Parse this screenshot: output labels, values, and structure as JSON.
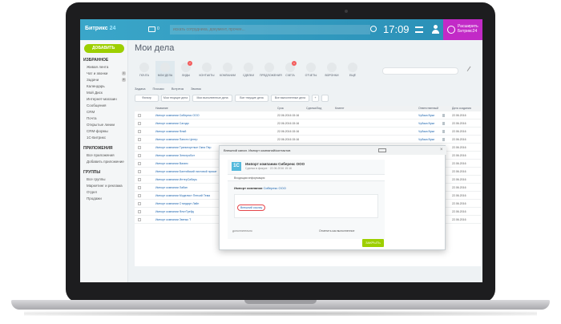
{
  "topbar": {
    "logo_name": "Битрикс",
    "logo_num": "24",
    "chat_count": "0",
    "search_placeholder": "искать сотрудника, документ, прочее...",
    "clock": "17:09",
    "expand_label_1": "Расширить",
    "expand_label_2": "Битрикс24"
  },
  "sidebar": {
    "add_label": "ДОБАВИТЬ",
    "section_favorites": "ИЗБРАННОЕ",
    "favorites": [
      "Живая лента",
      "Чат и звонки",
      "Задачи",
      "Календарь",
      "Мой Диск",
      "Интернет-магазин",
      "Сообщения",
      "CRM",
      "Почта",
      "Открытые линии",
      "CRM-формы",
      "1С-Битрикс"
    ],
    "badges": [
      "1",
      "8"
    ],
    "section_apps": "ПРИЛОЖЕНИЯ",
    "apps": [
      "Все приложения",
      "Добавить приложение"
    ],
    "section_groups": "ГРУППЫ",
    "groups": [
      "Все группы",
      "Маркетинг и реклама",
      "Отдел",
      "Продажи"
    ]
  },
  "page_title": "Мои дела",
  "tabs": [
    {
      "label": "ПОЧТА",
      "count": ""
    },
    {
      "label": "МОИ ДЕЛА",
      "count": ""
    },
    {
      "label": "ЛИДЫ",
      "count": "7"
    },
    {
      "label": "КОНТАКТЫ",
      "count": ""
    },
    {
      "label": "КОМПАНИИ",
      "count": ""
    },
    {
      "label": "СДЕЛКИ",
      "count": ""
    },
    {
      "label": "ПРЕДЛОЖЕНИЯ",
      "count": ""
    },
    {
      "label": "СЧЕТА",
      "count": "1"
    },
    {
      "label": "ОТЧЕТЫ",
      "count": ""
    },
    {
      "label": "ВОРОНКИ",
      "count": ""
    },
    {
      "label": "ЕЩЁ",
      "count": ""
    }
  ],
  "actions": [
    "Задача",
    "Письмо",
    "Встреча",
    "Звонок"
  ],
  "filters": [
    "Фильтр",
    "Мои текущие дела",
    "Мои выполненные дела",
    "Все текущие дела",
    "Все выполненные дела"
  ],
  "table": {
    "headers": [
      "Название",
      "Срок",
      "Сделка/Лид",
      "Клиент",
      "Ответственный",
      "Дата создания"
    ],
    "rows": [
      {
        "title": "Импорт компании Сиберекс ООО",
        "date": "22.06.2016 15:16",
        "resp": "Чубака Вуки",
        "cdate": "22.06.2016"
      },
      {
        "title": "Импорт компании Сагиди",
        "date": "22.06.2016 15:16",
        "resp": "Чубака Вуки",
        "cdate": "22.06.2016"
      },
      {
        "title": "Импорт компании Флай",
        "date": "22.06.2016 15:16",
        "resp": "Чубака Вуки",
        "cdate": "22.06.2016"
      },
      {
        "title": "Импорт компании Пансти Центр",
        "date": "22.06.2016 15:16",
        "resp": "Чубака Вуки",
        "cdate": "22.06.2016"
      },
      {
        "title": "Импорт компании Транспортные Окна Пер",
        "date": "22.06.2016 15:16",
        "resp": "Чубака Вуки",
        "cdate": "22.06.2016"
      },
      {
        "title": "Импорт компании ЭлектроБит",
        "date": "22.06.2016 15:16",
        "resp": "Чубака Вуки",
        "cdate": "22.06.2016"
      },
      {
        "title": "Импорт компании Ваганс",
        "date": "22.06.2016 15:16",
        "resp": "Чубака Вуки",
        "cdate": "22.06.2016"
      },
      {
        "title": "Импорт компании Балтийский листовой прокат",
        "date": "22.06.2016 15:16",
        "resp": "Чубака Вуки",
        "cdate": "22.06.2016"
      },
      {
        "title": "Импорт компании ИнтерСибирь",
        "date": "22.06.2016 15:16",
        "resp": "Чубака Вуки",
        "cdate": "22.06.2016"
      },
      {
        "title": "Импорт компании Лабан",
        "date": "22.06.2016 15:16",
        "resp": "Чубака Вуки",
        "cdate": "22.06.2016"
      },
      {
        "title": "Импорт компании Моделист Пенсий Тема",
        "date": "22.06.2016 15:16",
        "resp": "Чубака Вуки",
        "cdate": "22.06.2016"
      },
      {
        "title": "Импорт компании Стандарт Лайн",
        "date": "22.06.2016 15:16",
        "resp": "Чубака Вуки",
        "cdate": "22.06.2016"
      },
      {
        "title": "Импорт компании ФлотТрейд",
        "date": "22.06.2016 15:16",
        "resp": "Чубака Вуки",
        "cdate": "22.06.2016"
      },
      {
        "title": "Импорт компании Звенко Т",
        "date": "22.06.2016 15:16",
        "resp": "Чубака Вуки",
        "cdate": "22.06.2016"
      }
    ]
  },
  "popup": {
    "head": "Внешний канал. Импорт компаний/контактов",
    "card_title": "Импорт компании Сиберекс ООО",
    "card_date": "Сделка в фокусе · 22.06.2016 15:16",
    "card_sub": "Входящая информация",
    "card_line_label": "Импорт компании",
    "card_line_link": "Сиберекс ООО",
    "card_link": "Внешний ссылку",
    "foot_left": "дополнительно",
    "foot_right": "Отметить как выполненное",
    "close_label": "ЗАКРЫТЬ"
  }
}
